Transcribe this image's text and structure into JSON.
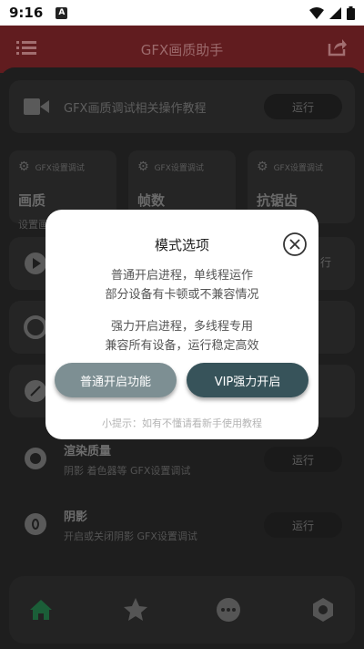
{
  "status_bar": {
    "time": "9:16",
    "notif_letter": "A",
    "icons": [
      "wifi-icon",
      "signal-icon",
      "battery-icon"
    ]
  },
  "header": {
    "title": "GFX画质助手",
    "icons": [
      "menu-icon",
      "share-icon"
    ]
  },
  "tutorial": {
    "title": "GFX画质调试相关操作教程",
    "run_label": "运行"
  },
  "tiles": [
    {
      "tag": "GFX设置调试",
      "name": "画质"
    },
    {
      "tag": "GFX设置调试",
      "name": "帧数"
    },
    {
      "tag": "GFX设置调试",
      "name": "抗锯齿"
    }
  ],
  "partial": {
    "tile_sub_prefix": "设置画",
    "run_fragment": "行"
  },
  "list": [
    {
      "title": "渲染质量",
      "subtitle": "阴影 着色器等 GFX设置调试",
      "run_label": "运行"
    },
    {
      "title": "阴影",
      "subtitle": "开启或关闭阴影 GFX设置调试",
      "run_label": "运行"
    }
  ],
  "nav": [
    "home-icon",
    "star-icon",
    "chat-icon",
    "settings-icon"
  ],
  "modal": {
    "title": "模式选项",
    "normal_line1": "普通开启进程，单线程运作",
    "normal_line2": "部分设备有卡顿或不兼容情况",
    "strong_line1": "强力开启进程，多线程专用",
    "strong_line2": "兼容所有设备，运行稳定高效",
    "normal_button": "普通开启功能",
    "vip_button": "VIP强力开启",
    "tip": "小提示：如有不懂请看新手使用教程"
  },
  "colors": {
    "header": "#611c1f",
    "vip": "#37535a",
    "normal": "#7d8f93",
    "home_active": "#1b5e38"
  }
}
